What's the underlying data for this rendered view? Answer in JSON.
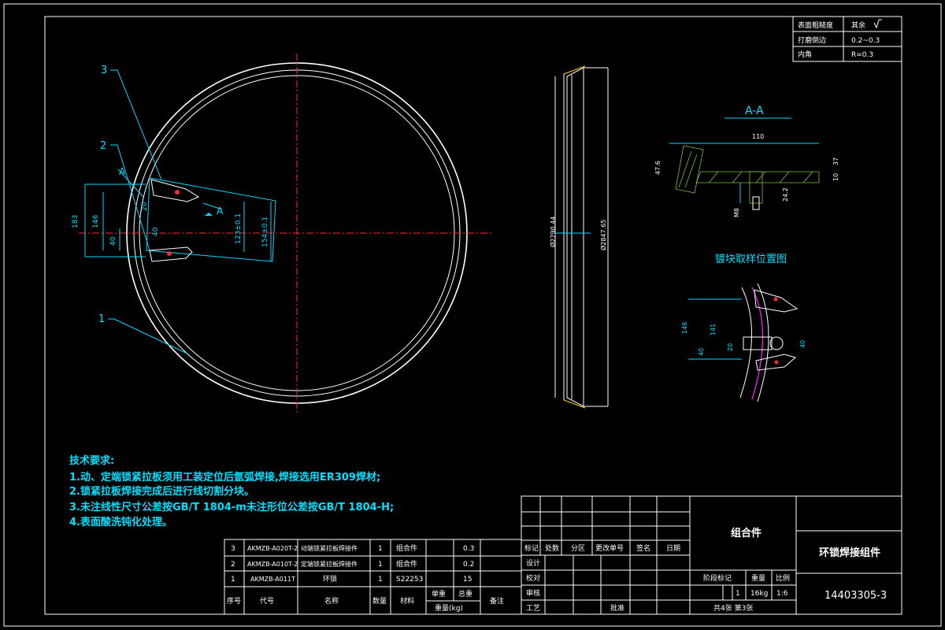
{
  "roughness_table": [
    {
      "label": "表面粗糙度",
      "value": "其余"
    },
    {
      "label": "打磨倒边",
      "value": "0.2~0.3"
    },
    {
      "label": "内角",
      "value": "R=0.3"
    }
  ],
  "section_view": {
    "title": "A-A",
    "dims": {
      "width": "110",
      "height_left": "47.6",
      "height_right": "37",
      "rib": "10",
      "stub": "24.2",
      "bottom": "M8"
    }
  },
  "sample_view": {
    "title": "镀块取样位置图",
    "dims": {
      "d1": "146",
      "d2": "141",
      "d3": "40",
      "d4": "20",
      "d5": "40"
    }
  },
  "main_view": {
    "callouts": [
      "3",
      "2",
      "1"
    ],
    "section_mark": "A",
    "dims": {
      "h": "183",
      "h2": "146",
      "w": "40",
      "a": "20",
      "b": "40",
      "c": "123±0.1",
      "d": "154±0.1"
    }
  },
  "side_view": {
    "dims": {
      "inner": "Ø2790.44",
      "outer": "Ø2847.65"
    }
  },
  "tech_notes": {
    "title": "技术要求:",
    "items": [
      "1.动、定端锁紧拉板须用工装定位后氩弧焊接,焊接选用ER309焊材;",
      "2.锁紧拉板焊接完成后进行线切割分块。",
      "3.未注线性尺寸公差按GB/T 1804-m未注形位公差按GB/T 1804-H;",
      "4.表面酸洗钝化处理。"
    ]
  },
  "bom": {
    "rows": [
      {
        "no": "3",
        "code": "AKMZB-A020T-2",
        "name": "动端锁紧拉板焊接件",
        "qty": "1",
        "material": "组合件",
        "unit": "0.3",
        "total": "",
        "remark": ""
      },
      {
        "no": "2",
        "code": "AKMZB-A010T-2",
        "name": "定端锁紧拉板焊接件",
        "qty": "1",
        "material": "组合件",
        "unit": "0.2",
        "total": "",
        "remark": ""
      },
      {
        "no": "1",
        "code": "AKMZB-A011T",
        "name": "环锁",
        "qty": "1",
        "material": "S22253",
        "unit": "15",
        "total": "",
        "remark": ""
      }
    ],
    "header": {
      "no": "序号",
      "code": "代号",
      "name": "名称",
      "qty": "数量",
      "material": "材料",
      "unit": "单重",
      "total": "总重",
      "weight": "重量(kg)",
      "remark": "备注"
    }
  },
  "title_block": {
    "sign_labels": [
      "标记",
      "处数",
      "分区",
      "更改单号",
      "签名",
      "日期"
    ],
    "roles": [
      "设计",
      "校对",
      "审核",
      "工艺"
    ],
    "approve": "批准",
    "category": "组合件",
    "stage_label": "阶段标记",
    "weight_label": "重量",
    "scale_label": "比例",
    "stage_value": "1",
    "weight_value": "16kg",
    "scale_value": "1:6",
    "sheets": "共4张  第3张",
    "part_name": "环锁焊接组件",
    "drawing_no": "14403305-3"
  },
  "colors": {
    "cyan": "#00e0ff",
    "red": "#ff2a2a",
    "green": "#7cc23a",
    "magenta": "#e020e0"
  }
}
